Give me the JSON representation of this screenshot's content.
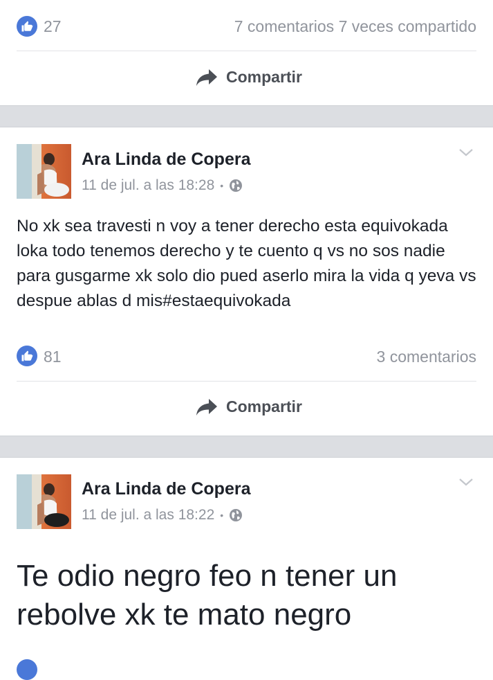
{
  "top_post": {
    "likes": "27",
    "comments_shares": "7 comentarios 7 veces compartido",
    "share_label": "Compartir"
  },
  "post1": {
    "author": "Ara Linda de Copera",
    "timestamp": "11 de jul. a las 18:28",
    "text": "No xk sea travesti n voy a tener derecho esta equivokada loka todo tenemos derecho y te cuento q vs no sos nadie para gusgarme xk solo dio pued aserlo mira la vida q yeva vs despue ablas d mis#estaequivokada",
    "likes": "81",
    "comments": "3 comentarios",
    "share_label": "Compartir"
  },
  "post2": {
    "author": "Ara Linda de Copera",
    "timestamp": "11 de jul. a las 18:22",
    "text": "Te odio negro feo n tener un rebolve xk te mato negro"
  },
  "colors": {
    "like_blue": "#4a78d8",
    "meta_gray": "#90949c",
    "separator": "#dcdee2",
    "text": "#1d2129"
  },
  "icons": [
    "like-icon",
    "share-arrow-icon",
    "globe-icon",
    "chevron-down-icon"
  ]
}
